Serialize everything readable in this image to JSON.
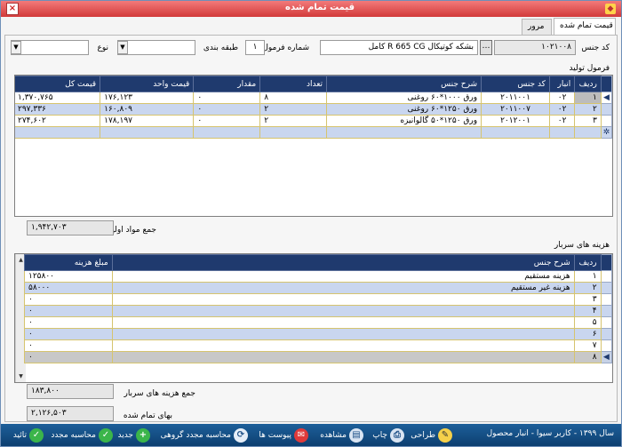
{
  "window": {
    "title": "قیمت تمام شده"
  },
  "tabs": [
    {
      "label": "قیمت تمام شده"
    },
    {
      "label": "مرور"
    }
  ],
  "form": {
    "code_label": "کد جنس",
    "code_value": "۱۰۲۱۰۰۸",
    "desc_value": "بشکه کوتیکال R 665 CG کامل",
    "formula_label": "شماره فرمول",
    "formula_value": "۱",
    "class_label": "طبقه بندی",
    "class_value": "",
    "type_label": "نوع",
    "type_value": ""
  },
  "production": {
    "section_label": "فرمول تولید",
    "headers": [
      "ردیف",
      "انبار",
      "کد جنس",
      "شرح جنس",
      "تعداد",
      "مقدار",
      "قیمت واحد",
      "قیمت کل"
    ],
    "rows": [
      [
        "۱",
        "۰۲",
        "۲۰۱۱۰۰۱",
        "ورق ۱۰۰۰*۶۰ روغنی",
        "۸",
        "۰",
        "۱۷۶,۱۲۳",
        "۱,۳۷۰,۷۶۵"
      ],
      [
        "۲",
        "۰۲",
        "۲۰۱۱۰۰۷",
        "ورق ۱۲۵۰*۶۰ روغنی",
        "۲",
        "۰",
        "۱۶۰,۸۰۹",
        "۲۹۷,۳۳۶"
      ],
      [
        "۳",
        "۰۲",
        "۲۰۱۲۰۰۱",
        "ورق ۱۲۵۰*۵۰ گالوانیزه",
        "۲",
        "۰",
        "۱۷۸,۱۹۷",
        "۲۷۴,۶۰۲"
      ]
    ],
    "total_label": "جمع مواد اولیه",
    "total_value": "۱,۹۴۲,۷۰۳"
  },
  "overhead": {
    "section_label": "هزینه های سربار",
    "headers": [
      "ردیف",
      "شرح جنس",
      "مبلغ هزینه"
    ],
    "rows": [
      [
        "۱",
        "هزینه مستقیم",
        "۱۲۵۸۰۰"
      ],
      [
        "۲",
        "هزینه غیر مستقیم",
        "۵۸۰۰۰"
      ],
      [
        "۳",
        "",
        "۰"
      ],
      [
        "۴",
        "",
        "۰"
      ],
      [
        "۵",
        "",
        "۰"
      ],
      [
        "۶",
        "",
        "۰"
      ],
      [
        "۷",
        "",
        "۰"
      ],
      [
        "۸",
        "",
        "۰"
      ]
    ],
    "total_label": "جمع هزینه های سربار",
    "total_value": "۱۸۳,۸۰۰"
  },
  "final": {
    "label": "بهای تمام شده",
    "value": "۲,۱۲۶,۵۰۳"
  },
  "toolbar": {
    "status": "سال ۱۳۹۹ - کاربر سیوا - انبار محصول",
    "design": "طراحی",
    "print": "چاپ",
    "view": "مشاهده",
    "attachments": "پیوست ها",
    "group_recalc": "محاسبه مجدد گروهی",
    "new": "جدید",
    "recalc": "محاسبه مجدد",
    "confirm": "تائید"
  }
}
